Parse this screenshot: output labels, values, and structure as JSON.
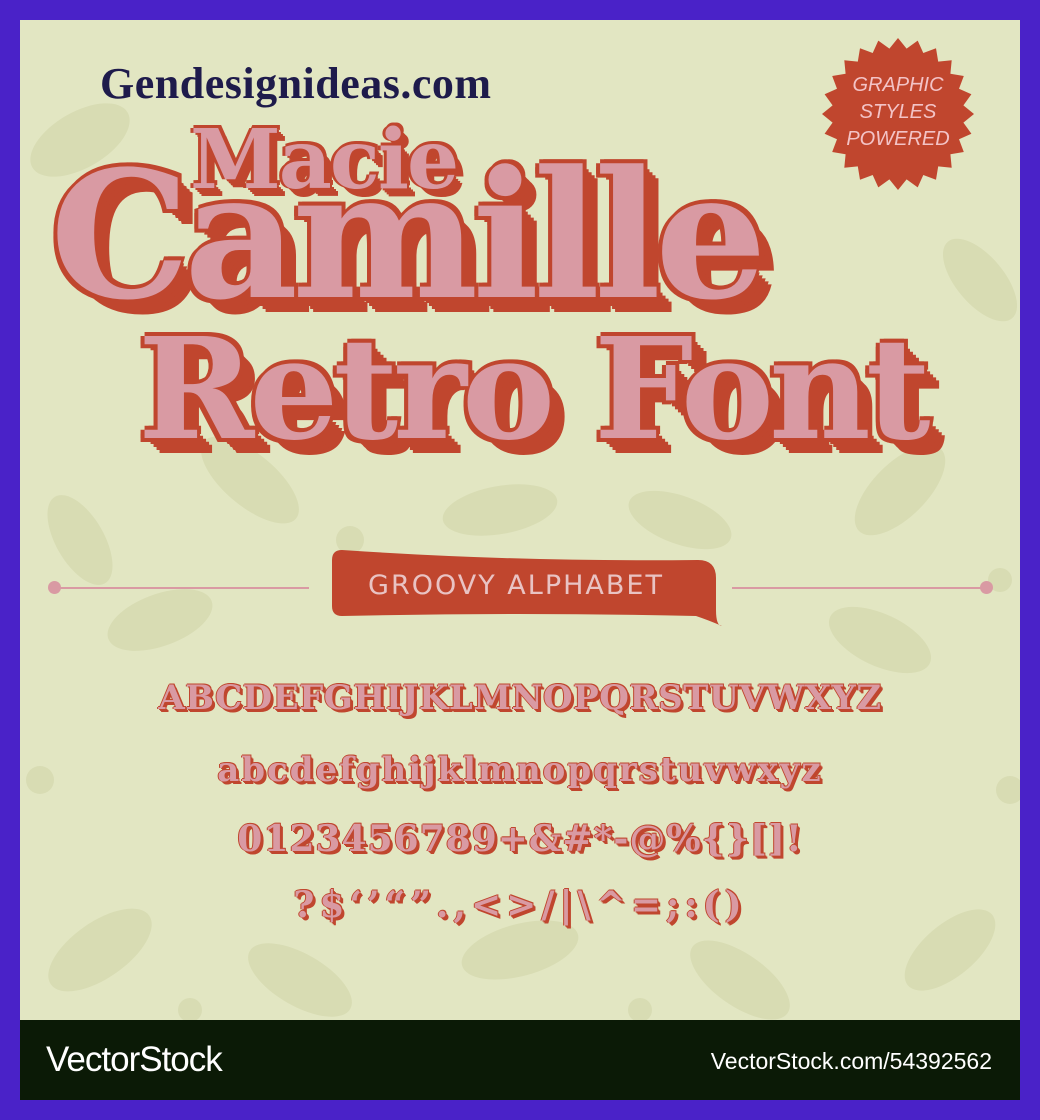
{
  "site_name": "Gendesignideas.com",
  "badge": {
    "lines": [
      "GRAPHIC",
      "STYLES",
      "POWERED"
    ]
  },
  "title": {
    "line1": "Macie",
    "line2": "Camille",
    "line3": "Retro Font"
  },
  "section_label": "GROOVY ALPHABET",
  "alphabet": {
    "uppercase": "ABCDEFGHIJKLMNOPQRSTUVWXYZ",
    "lowercase": "abcdefghijklmnopqrstuvwxyz",
    "numerals_symbols": "0123456789+&#*-@%{}[]!",
    "punctuation": "?$‘’“”.,<>/|\\^=;:()"
  },
  "footer": {
    "brand": "VectorStock",
    "reference": "VectorStock.com/54392562"
  },
  "colors": {
    "frame": "#4a22c8",
    "background": "#e2e6c2",
    "pink": "#d99aa3",
    "rust": "#c0462e",
    "footer": "#0b1a06"
  }
}
